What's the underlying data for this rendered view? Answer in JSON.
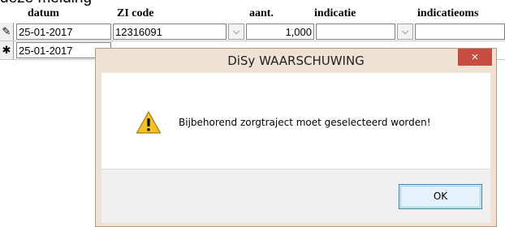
{
  "caption": "deze melding",
  "grid": {
    "columns": {
      "datum": "datum",
      "zi_code": "ZI code",
      "aant": "aant.",
      "indicatie": "indicatie",
      "indicatieomschrijving": "indicatieoms"
    },
    "rows": [
      {
        "selector_glyph": "✎",
        "datum": "25-01-2017",
        "zi_code": "12316091",
        "aant": "1,000",
        "indicatie": ""
      },
      {
        "selector_glyph": "✱",
        "datum": "25-01-2017"
      }
    ]
  },
  "dialog": {
    "title": "DiSy WAARSCHUWING",
    "close_glyph": "×",
    "icon": "warning-icon",
    "message": "Bijbehorend zorgtraject moet geselecteerd worden!",
    "ok_label": "OK"
  },
  "colors": {
    "close_button": "#c74d43",
    "dialog_frame": "#efe2d4"
  }
}
